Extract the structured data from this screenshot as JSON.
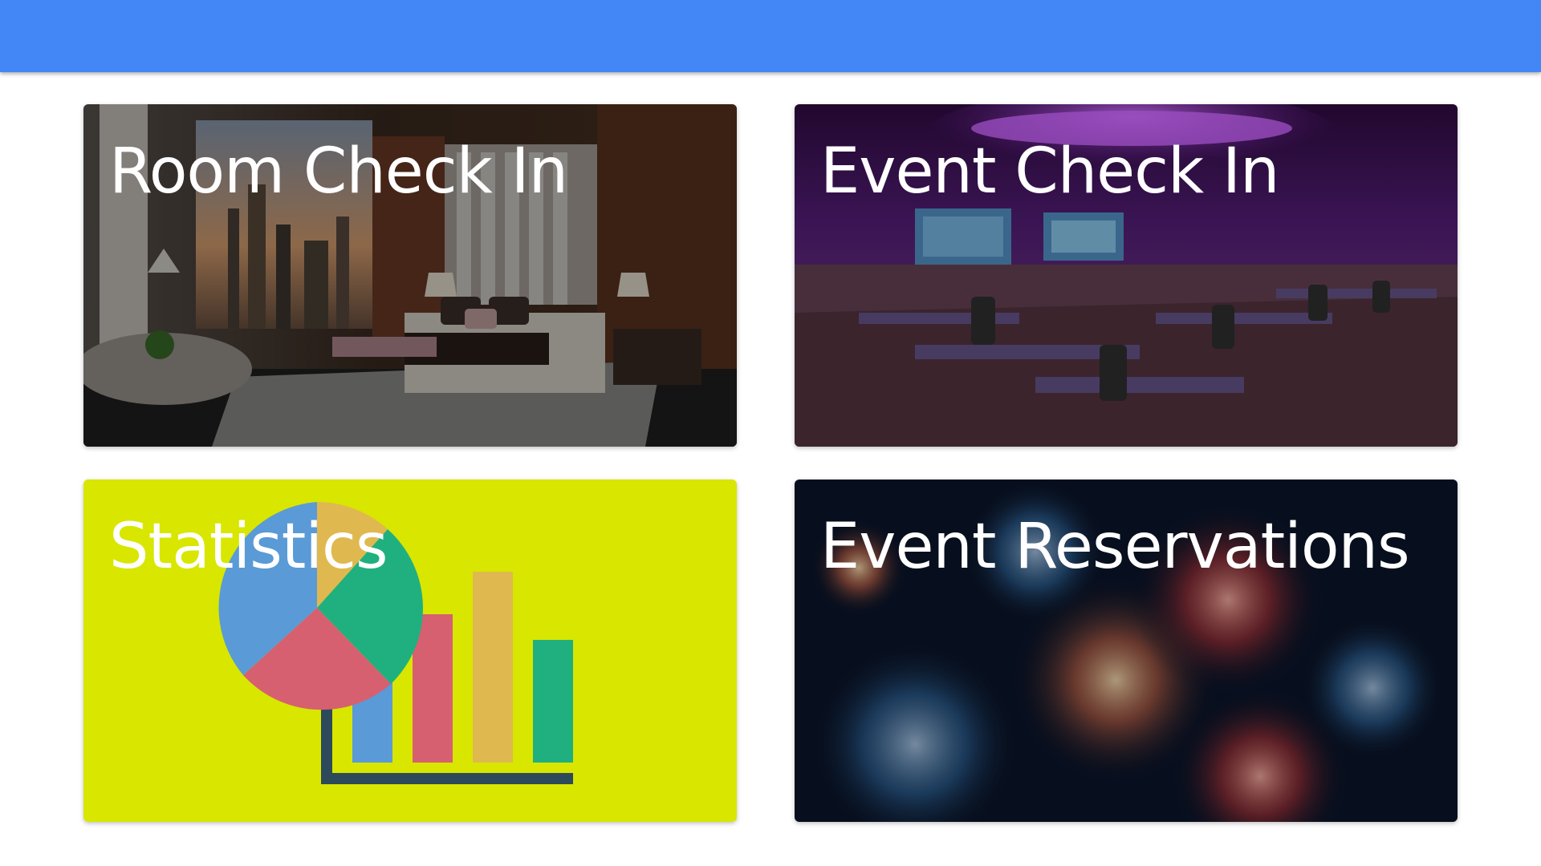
{
  "header": {
    "color": "#4287f5"
  },
  "tiles": [
    {
      "label": "Room Check In",
      "icon": "hotel-room-image"
    },
    {
      "label": "Event Check In",
      "icon": "banquet-hall-image"
    },
    {
      "label": "Statistics",
      "icon": "pie-bar-chart-icon",
      "background": "#d8e600"
    },
    {
      "label": "Event Reservations",
      "icon": "fireworks-image"
    }
  ]
}
